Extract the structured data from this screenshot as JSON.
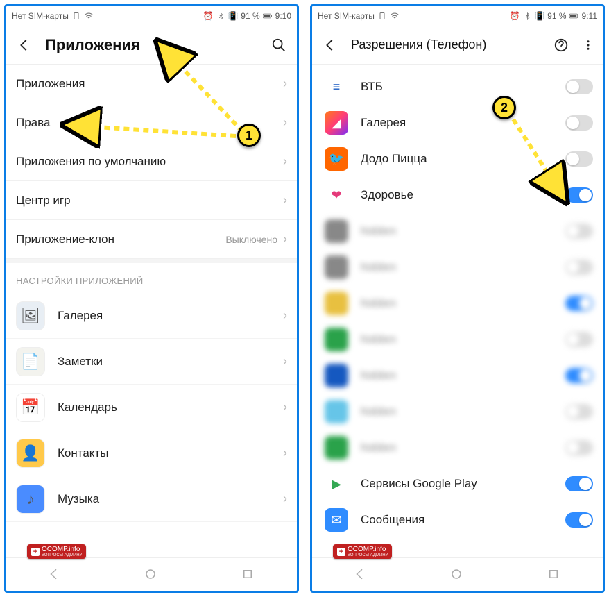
{
  "statusbar": {
    "carrier": "Нет SIM-карты",
    "battery": "91 %",
    "time_left": "9:10",
    "time_right": "9:11"
  },
  "left": {
    "header_title": "Приложения",
    "rows": [
      {
        "label": "Приложения"
      },
      {
        "label": "Права"
      },
      {
        "label": "Приложения по умолчанию"
      },
      {
        "label": "Центр игр"
      },
      {
        "label": "Приложение-клон",
        "meta": "Выключено"
      }
    ],
    "section_header": "НАСТРОЙКИ ПРИЛОЖЕНИЙ",
    "apps": [
      {
        "label": "Галерея",
        "icon_bg": "#e8eef4",
        "glyph": "🖼"
      },
      {
        "label": "Заметки",
        "icon_bg": "#f3f3ee",
        "glyph": "📄"
      },
      {
        "label": "Календарь",
        "icon_bg": "#fff",
        "glyph": "📅"
      },
      {
        "label": "Контакты",
        "icon_bg": "#ffc94a",
        "glyph": "👤"
      },
      {
        "label": "Музыка",
        "icon_bg": "#4a8cff",
        "glyph": "♪"
      }
    ]
  },
  "right": {
    "header_title": "Разрешения (Телефон)",
    "apps": [
      {
        "label": "ВТБ",
        "icon_bg": "#fff",
        "glyph": "≡",
        "glyph_color": "#1558c0",
        "on": false,
        "blur": false
      },
      {
        "label": "Галерея",
        "icon_bg": "linear-gradient(135deg,#ff7a18,#ff3d77,#7b2ff7)",
        "glyph": "◢",
        "on": false,
        "blur": false
      },
      {
        "label": "Додо Пицца",
        "icon_bg": "#ff6600",
        "glyph": "🐦",
        "on": false,
        "blur": false
      },
      {
        "label": "Здоровье",
        "icon_bg": "#fff",
        "glyph": "❤",
        "glyph_color": "#e5397a",
        "on": true,
        "blur": false
      },
      {
        "label": "hidden",
        "icon_bg": "#888",
        "on": false,
        "blur": true
      },
      {
        "label": "hidden",
        "icon_bg": "#888",
        "on": false,
        "blur": true
      },
      {
        "label": "hidden",
        "icon_bg": "#e8c040",
        "on": true,
        "blur": true
      },
      {
        "label": "hidden",
        "icon_bg": "#2aa24a",
        "on": false,
        "blur": true
      },
      {
        "label": "hidden",
        "icon_bg": "#1558c0",
        "on": true,
        "blur": true
      },
      {
        "label": "hidden",
        "icon_bg": "#66c5e8",
        "on": false,
        "blur": true
      },
      {
        "label": "hidden",
        "icon_bg": "#2aa24a",
        "on": false,
        "blur": true
      },
      {
        "label": "Сервисы Google Play",
        "icon_bg": "#fff",
        "glyph": "▶",
        "glyph_color": "#34a853",
        "on": true,
        "blur": false
      },
      {
        "label": "Сообщения",
        "icon_bg": "#2f8cff",
        "glyph": "✉",
        "on": true,
        "blur": false
      }
    ]
  },
  "annotations": {
    "badge1": "1",
    "badge2": "2"
  },
  "watermark": {
    "main": "OCOMP.info",
    "sub": "ВОПРОСЫ АДМИНУ"
  }
}
